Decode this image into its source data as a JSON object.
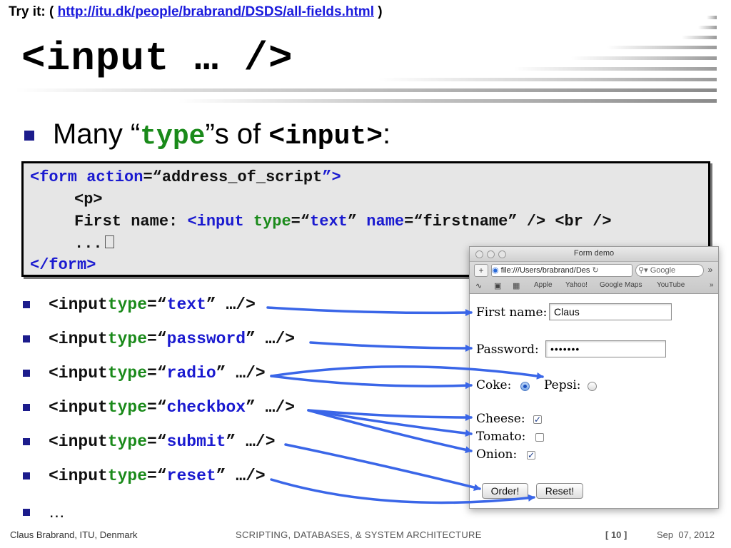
{
  "header": {
    "tryit_prefix": "Try it: ( ",
    "tryit_link": "http://itu.dk/people/brabrand/DSDS/all-fields.html",
    "tryit_suffix": " )",
    "title": "<input … />"
  },
  "intro": {
    "pre": "Many “",
    "type_word": "type",
    "mid": "”s of ",
    "input_tag": "<input>",
    "post": ":"
  },
  "code": {
    "l1_a": "<form ",
    "l1_b": "action",
    "l1_c": "=“",
    "l1_d": "address_of_script",
    "l1_e": "”>",
    "l2": "<p>",
    "l3_a": "First name: ",
    "l3_b": "<input ",
    "l3_c": "type",
    "l3_d": "=“",
    "l3_e": "text",
    "l3_f": "” ",
    "l3_g": "name",
    "l3_h": "=“",
    "l3_i": "firstname",
    "l3_j": "” />",
    "l3_k": " <br />",
    "l4": "...",
    "l5": "</form>"
  },
  "input_list": [
    {
      "tag": "<input ",
      "attr": "type",
      "eq": "=“",
      "val": "text",
      "close": "” …/>"
    },
    {
      "tag": "<input ",
      "attr": "type",
      "eq": "=“",
      "val": "password",
      "close": "” …/>"
    },
    {
      "tag": "<input ",
      "attr": "type",
      "eq": "=“",
      "val": "radio",
      "close": "” …/>"
    },
    {
      "tag": "<input ",
      "attr": "type",
      "eq": "=“",
      "val": "checkbox",
      "close": "” …/>"
    },
    {
      "tag": "<input ",
      "attr": "type",
      "eq": "=“",
      "val": "submit",
      "close": "” …/>"
    },
    {
      "tag": "<input ",
      "attr": "type",
      "eq": "=“",
      "val": "reset",
      "close": "” …/>"
    }
  ],
  "list_more": "…",
  "browser": {
    "window_title": "Form demo",
    "url": "file:///Users/brabrand/Des",
    "search_placeholder": "Google",
    "bookmarks": [
      "Apple",
      "Yahoo!",
      "Google Maps",
      "YouTube"
    ],
    "firstname_label": "First name:",
    "firstname_value": "Claus",
    "password_label": "Password:",
    "password_value": "•••••••",
    "coke_label": "Coke:",
    "pepsi_label": "Pepsi:",
    "cheese_label": "Cheese:",
    "tomato_label": "Tomato:",
    "onion_label": "Onion:",
    "submit_label": "Order!",
    "reset_label": "Reset!",
    "coke_selected": true,
    "pepsi_selected": false,
    "cheese_checked": true,
    "tomato_checked": false,
    "onion_checked": true
  },
  "footer": {
    "author": "Claus Brabrand, ITU, Denmark",
    "course": "SCRIPTING, DATABASES, & SYSTEM ARCHITECTURE",
    "page": "[ 10 ]",
    "date": "Sep  07, 2012"
  },
  "colors": {
    "arrow": "#3a66e8",
    "keyword_blue": "#1a1ad0",
    "keyword_green": "#1a8a1a",
    "bullet": "#1c1c8c"
  }
}
